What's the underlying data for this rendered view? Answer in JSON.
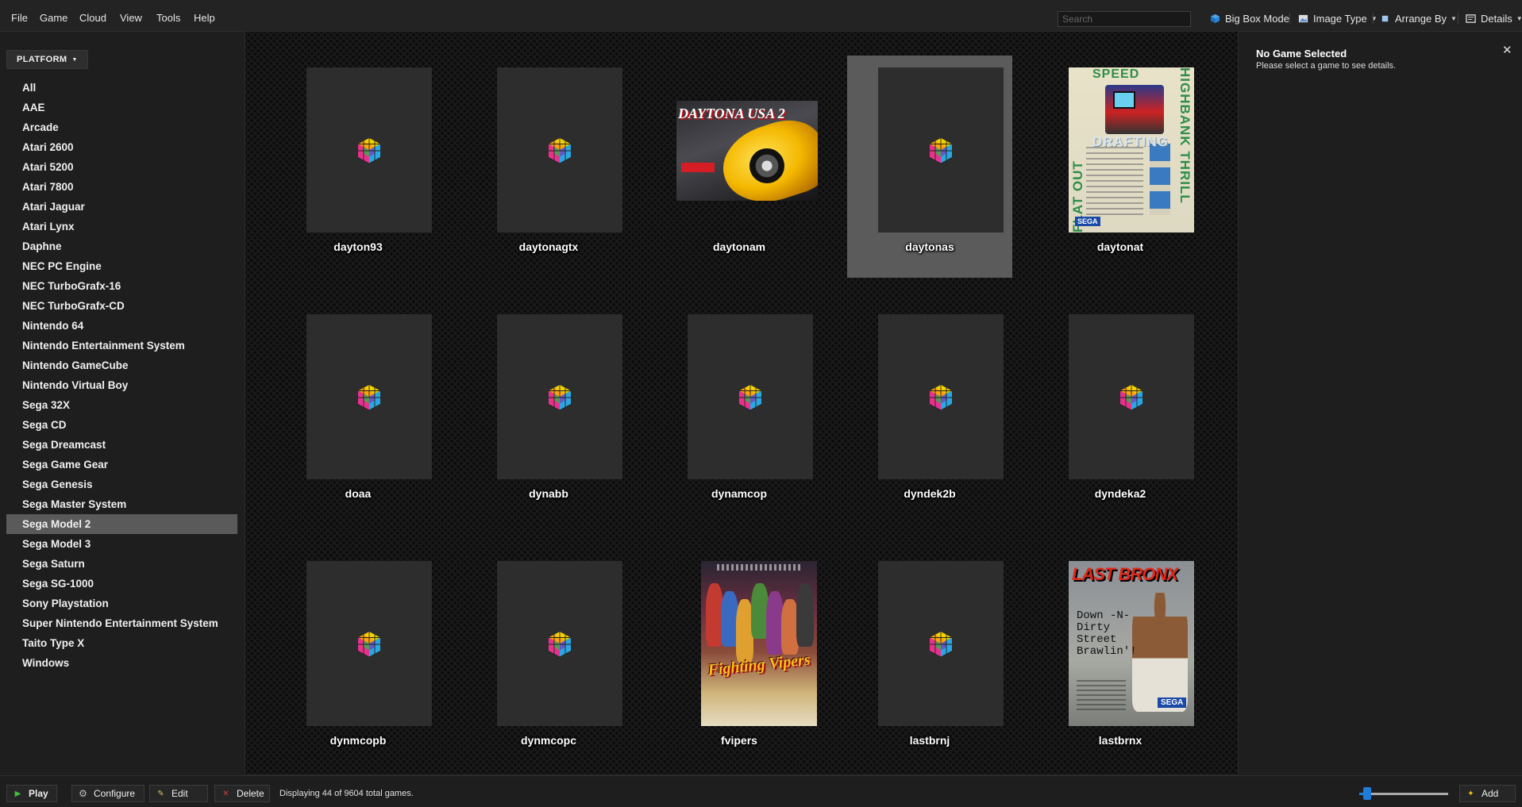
{
  "menu": [
    "File",
    "Game",
    "Cloud",
    "View",
    "Tools",
    "Help"
  ],
  "search": {
    "placeholder": "Search",
    "value": ""
  },
  "toolbar": {
    "big_box_mode": "Big Box Mode",
    "image_type": "Image Type",
    "arrange_by": "Arrange By",
    "details": "Details"
  },
  "sidebar": {
    "filter_label": "PLATFORM",
    "selected": "Sega Model 2",
    "items": [
      "All",
      "AAE",
      "Arcade",
      "Atari 2600",
      "Atari 5200",
      "Atari 7800",
      "Atari Jaguar",
      "Atari Lynx",
      "Daphne",
      "NEC PC Engine",
      "NEC TurboGrafx-16",
      "NEC TurboGrafx-CD",
      "Nintendo 64",
      "Nintendo Entertainment System",
      "Nintendo GameCube",
      "Nintendo Virtual Boy",
      "Sega 32X",
      "Sega CD",
      "Sega Dreamcast",
      "Sega Game Gear",
      "Sega Genesis",
      "Sega Master System",
      "Sega Model 2",
      "Sega Model 3",
      "Sega Saturn",
      "Sega SG-1000",
      "Sony Playstation",
      "Super Nintendo Entertainment System",
      "Taito Type X",
      "Windows"
    ]
  },
  "games": [
    {
      "name": "dayton93",
      "art": "placeholder"
    },
    {
      "name": "daytonagtx",
      "art": "placeholder"
    },
    {
      "name": "daytonam",
      "art": "daytona"
    },
    {
      "name": "daytonas",
      "art": "placeholder",
      "selected": true
    },
    {
      "name": "daytonat",
      "art": "daytonat"
    },
    {
      "name": "doaa",
      "art": "placeholder"
    },
    {
      "name": "dynabb",
      "art": "placeholder"
    },
    {
      "name": "dynamcop",
      "art": "placeholder"
    },
    {
      "name": "dyndek2b",
      "art": "placeholder"
    },
    {
      "name": "dyndeka2",
      "art": "placeholder"
    },
    {
      "name": "dynmcopb",
      "art": "placeholder"
    },
    {
      "name": "dynmcopc",
      "art": "placeholder"
    },
    {
      "name": "fvipers",
      "art": "fvipers"
    },
    {
      "name": "lastbrnj",
      "art": "placeholder"
    },
    {
      "name": "lastbrnx",
      "art": "lastbronx"
    }
  ],
  "box_art_text": {
    "daytonam": "DAYTONA USA 2",
    "daytonat_top": "SPEED",
    "daytonat_left": "FLAT OUT",
    "daytonat_right": "HIGHBANK THRILL",
    "daytonat_mid": "DRAFTING",
    "sega": "SEGA",
    "fvipers": "Fighting Vipers",
    "lastbronx_logo": "LAST BRONX",
    "lastbronx_tag": "Down -N- Dirty Street Brawlin'!"
  },
  "details": {
    "title": "No Game Selected",
    "subtitle": "Please select a game to see details."
  },
  "bottom": {
    "play": "Play",
    "configure": "Configure",
    "edit": "Edit",
    "delete": "Delete",
    "status": "Displaying 44 of 9604 total games.",
    "add": "Add",
    "zoom_level": 0.06
  },
  "colors": {
    "accent": "#1e7dd8",
    "selection": "#5a5a5a",
    "play_icon": "#3fbf3f",
    "delete_icon": "#d23a3a",
    "add_icon": "#f0c020"
  }
}
